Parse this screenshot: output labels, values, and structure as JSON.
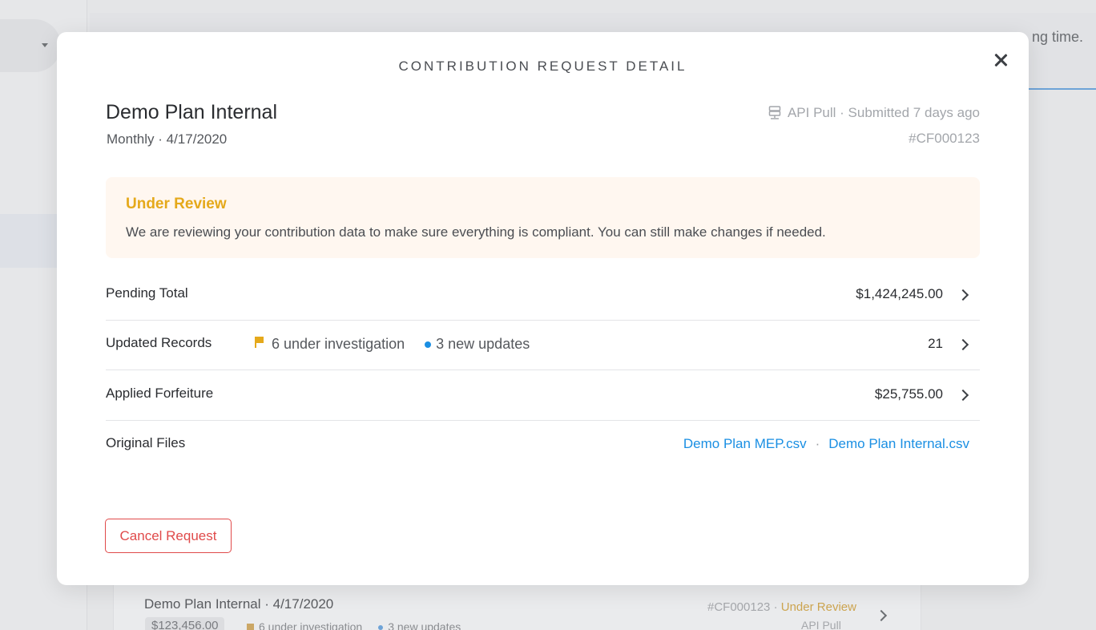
{
  "background": {
    "banner_text": "ng time.",
    "card": {
      "title": "Demo Plan Internal · 4/17/2020",
      "amount": "$123,456.00",
      "investigation": "6 under investigation",
      "updates": "3 new updates",
      "id": "#CF000123",
      "id_sep": " · ",
      "status": "Under Review",
      "source": "API Pull"
    }
  },
  "modal": {
    "heading": "CONTRIBUTION REQUEST DETAIL",
    "plan_title": "Demo Plan Internal",
    "plan_subtitle": "Monthly · 4/17/2020",
    "source_text": "API Pull · Submitted 7 days ago",
    "request_id": "#CF000123",
    "status": {
      "title": "Under Review",
      "message": "We are reviewing your contribution data to make sure everything is compliant. You can still make changes if needed.",
      "accent_color": "#e5a91b",
      "background_color": "#fff7f0"
    },
    "rows": {
      "pending_total": {
        "label": "Pending Total",
        "value": "$1,424,245.00"
      },
      "updated_records": {
        "label": "Updated Records",
        "investigation": "6 under investigation",
        "new_updates": "3 new updates",
        "value": "21"
      },
      "applied_forfeiture": {
        "label": "Applied Forfeiture",
        "value": "$25,755.00"
      },
      "original_files": {
        "label": "Original Files",
        "files": [
          "Demo Plan MEP.csv",
          "Demo Plan Internal.csv"
        ],
        "separator": "·"
      }
    },
    "cancel_label": "Cancel Request"
  },
  "colors": {
    "link": "#1a8fe3",
    "danger": "#e04a4a",
    "flag": "#e5a91b"
  },
  "icons": {
    "close": "close-icon",
    "source": "server-icon",
    "flag": "flag-icon",
    "dot": "dot-icon",
    "chevron": "chevron-right-icon"
  }
}
